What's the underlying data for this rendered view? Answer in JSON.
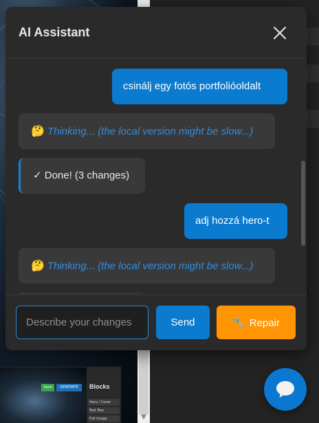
{
  "chat": {
    "title": "AI Assistant",
    "messages": [
      {
        "role": "user",
        "text": "csinálj egy fotós portfolióoldalt"
      },
      {
        "role": "assistant",
        "emoji": "🤔",
        "text": "Thinking... (the local version might be slow...)"
      },
      {
        "role": "assistant",
        "text": "✓ Done! (3 changes)"
      },
      {
        "role": "user",
        "text": "adj hozzá hero-t"
      },
      {
        "role": "assistant",
        "emoji": "🤔",
        "text": "Thinking... (the local version might be slow...)"
      }
    ],
    "input_placeholder": "Describe your changes",
    "input_value": "",
    "send_label": "Send",
    "repair_label": "Repair",
    "repair_icon": "🔧"
  },
  "background_editor": {
    "save_label": "Save",
    "generate_label": "GENERATE",
    "panel_title": "Blocks",
    "block_items": [
      "Hero / Cover",
      "Text Box",
      "Full Image"
    ]
  },
  "colors": {
    "accent": "#0b7bd0",
    "repair": "#ff9505",
    "panel_bg": "#2a2a2a",
    "thinking_text": "#2f8de0"
  }
}
